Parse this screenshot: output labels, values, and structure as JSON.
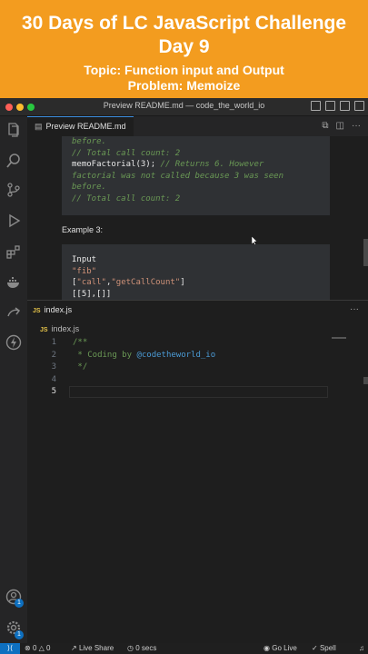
{
  "banner": {
    "line1": "30 Days of LC JavaScript Challenge",
    "line2": "Day 9",
    "line3": "Topic: Function input and Output",
    "line4": "Problem: Memoize"
  },
  "window": {
    "title": "Preview README.md — code_the_world_io"
  },
  "preview": {
    "tab_label": "Preview README.md",
    "block1": {
      "l1": "before.",
      "l2": "// Total call count: 2",
      "l3a": "memoFactorial(3);",
      "l3b": " // Returns 6. However",
      "l4": "factorial was not called because 3 was seen",
      "l5": "before.",
      "l6": "// Total call count: 2"
    },
    "example_label": "Example 3:",
    "block2": {
      "l1": "Input",
      "l2": "\"fib\"",
      "l3": "[\"call\",\"getCallCount\"]",
      "l4": "[[5],[]]"
    }
  },
  "editor": {
    "tab_label": "index.js",
    "breadcrumb": "index.js",
    "line_numbers": [
      "1",
      "2",
      "3",
      "4",
      "5"
    ],
    "lines": [
      "/**",
      " * Coding by ",
      " */",
      "",
      ""
    ],
    "handle": "@codetheworld_io"
  },
  "activity_badges": {
    "accounts": "1",
    "settings": "1"
  },
  "statusbar": {
    "errors": "0",
    "warnings": "0",
    "live_share": "Live Share",
    "timer": "0 secs",
    "go_live": "Go Live",
    "spell": "Spell"
  }
}
